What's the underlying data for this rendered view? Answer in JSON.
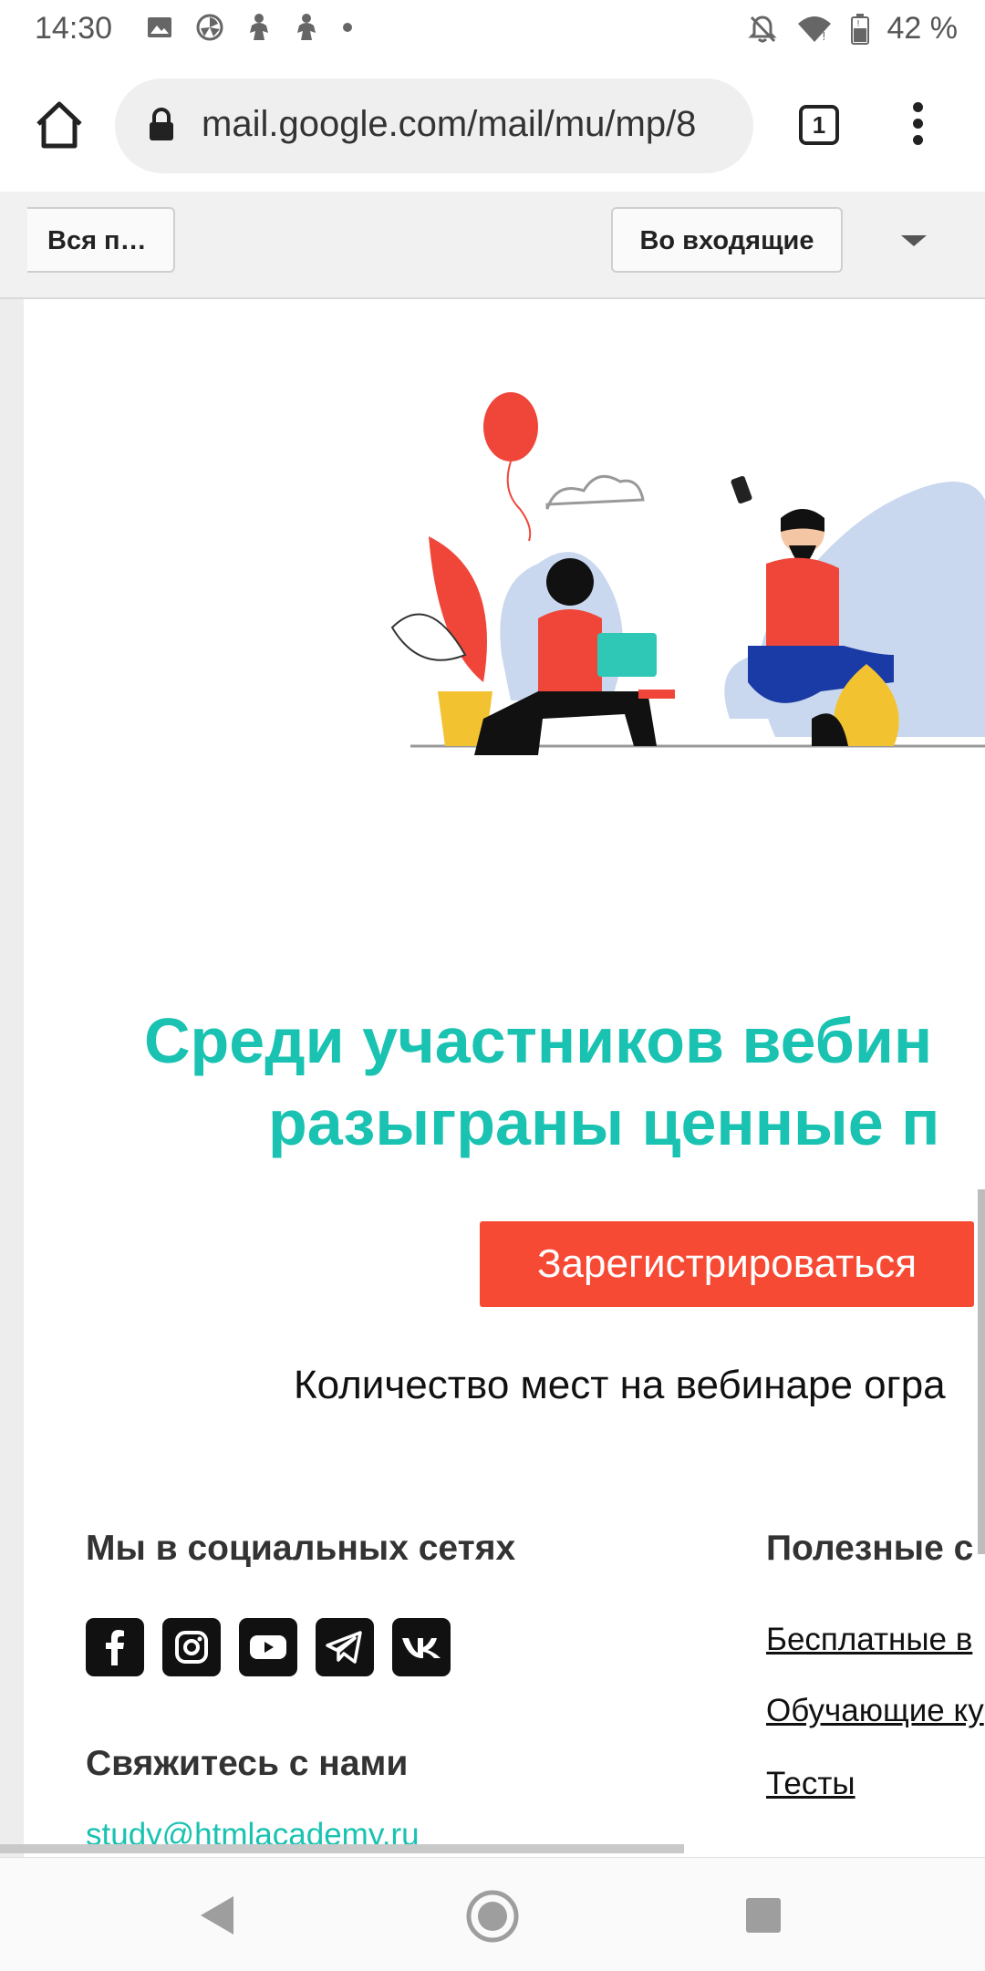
{
  "status_bar": {
    "time": "14:30",
    "left_icons": [
      "image-icon",
      "pinwheel-icon",
      "figure-icon",
      "figure-icon",
      "dot-icon"
    ],
    "right_icons": [
      "bell-off-icon",
      "wifi-icon",
      "battery-icon"
    ],
    "battery": "42 %"
  },
  "browser": {
    "url": "mail.google.com/mail/mu/mp/8",
    "tabs_count": "1"
  },
  "gmail_toolbar": {
    "back_label": "Вся п…",
    "inbox_label": "Во входящие"
  },
  "email": {
    "headline_line1": "Среди участников вебин",
    "headline_line2": "разыграны ценные п",
    "register_label": "Зарегистрироваться",
    "seats_text": "Количество мест на вебинаре огра",
    "social_title": "Мы в социальных сетях",
    "social_icons": [
      "facebook-icon",
      "instagram-icon",
      "youtube-icon",
      "telegram-icon",
      "vk-icon"
    ],
    "contact_title": "Свяжитесь с нами",
    "contact_email": "study@htmlacademy.ru",
    "useful_title": "Полезные с",
    "useful_links": [
      "Бесплатные в",
      "Обучающие ку",
      "Тесты"
    ]
  },
  "colors": {
    "accent": "#19c2b1",
    "button": "#f74a34"
  }
}
